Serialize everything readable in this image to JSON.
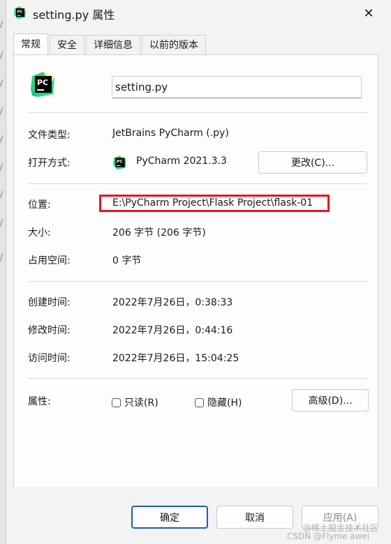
{
  "window": {
    "title": "setting.py 属性",
    "close_glyph": "✕"
  },
  "tabs": [
    {
      "label": "常规",
      "active": true
    },
    {
      "label": "安全",
      "active": false
    },
    {
      "label": "详细信息",
      "active": false
    },
    {
      "label": "以前的版本",
      "active": false
    }
  ],
  "general": {
    "file_name": "setting.py",
    "file_type_label": "文件类型:",
    "file_type_value": "JetBrains PyCharm (.py)",
    "opens_with_label": "打开方式:",
    "opens_with_value": "PyCharm 2021.3.3",
    "change_button": "更改(C)...",
    "location_label": "位置:",
    "location_value": "E:\\PyCharm Project\\Flask Project\\flask-01",
    "size_label": "大小:",
    "size_value": "206 字节 (206 字节)",
    "size_on_disk_label": "占用空间:",
    "size_on_disk_value": "0 字节",
    "created_label": "创建时间:",
    "created_value": "2022年7月26日，0:38:33",
    "modified_label": "修改时间:",
    "modified_value": "2022年7月26日，0:44:16",
    "accessed_label": "访问时间:",
    "accessed_value": "2022年7月26日，15:04:25",
    "attributes_label": "属性:",
    "readonly_label": "只读(R)",
    "readonly_checked": false,
    "hidden_label": "隐藏(H)",
    "hidden_checked": false,
    "advanced_button": "高级(D)..."
  },
  "footer": {
    "ok_button": "确定",
    "cancel_button": "取消",
    "apply_button": "应用(A)",
    "apply_enabled": false
  },
  "icons": {
    "app_icon": "pycharm-icon",
    "icon_text": "PC"
  },
  "colors": {
    "highlight": "#e8141c",
    "ok_border": "#1a5fb4",
    "pycharm_green": "#21d789"
  },
  "watermark": {
    "line1": "@稀土掘金技术社区",
    "line2": "CSDN @Flyme awei"
  }
}
